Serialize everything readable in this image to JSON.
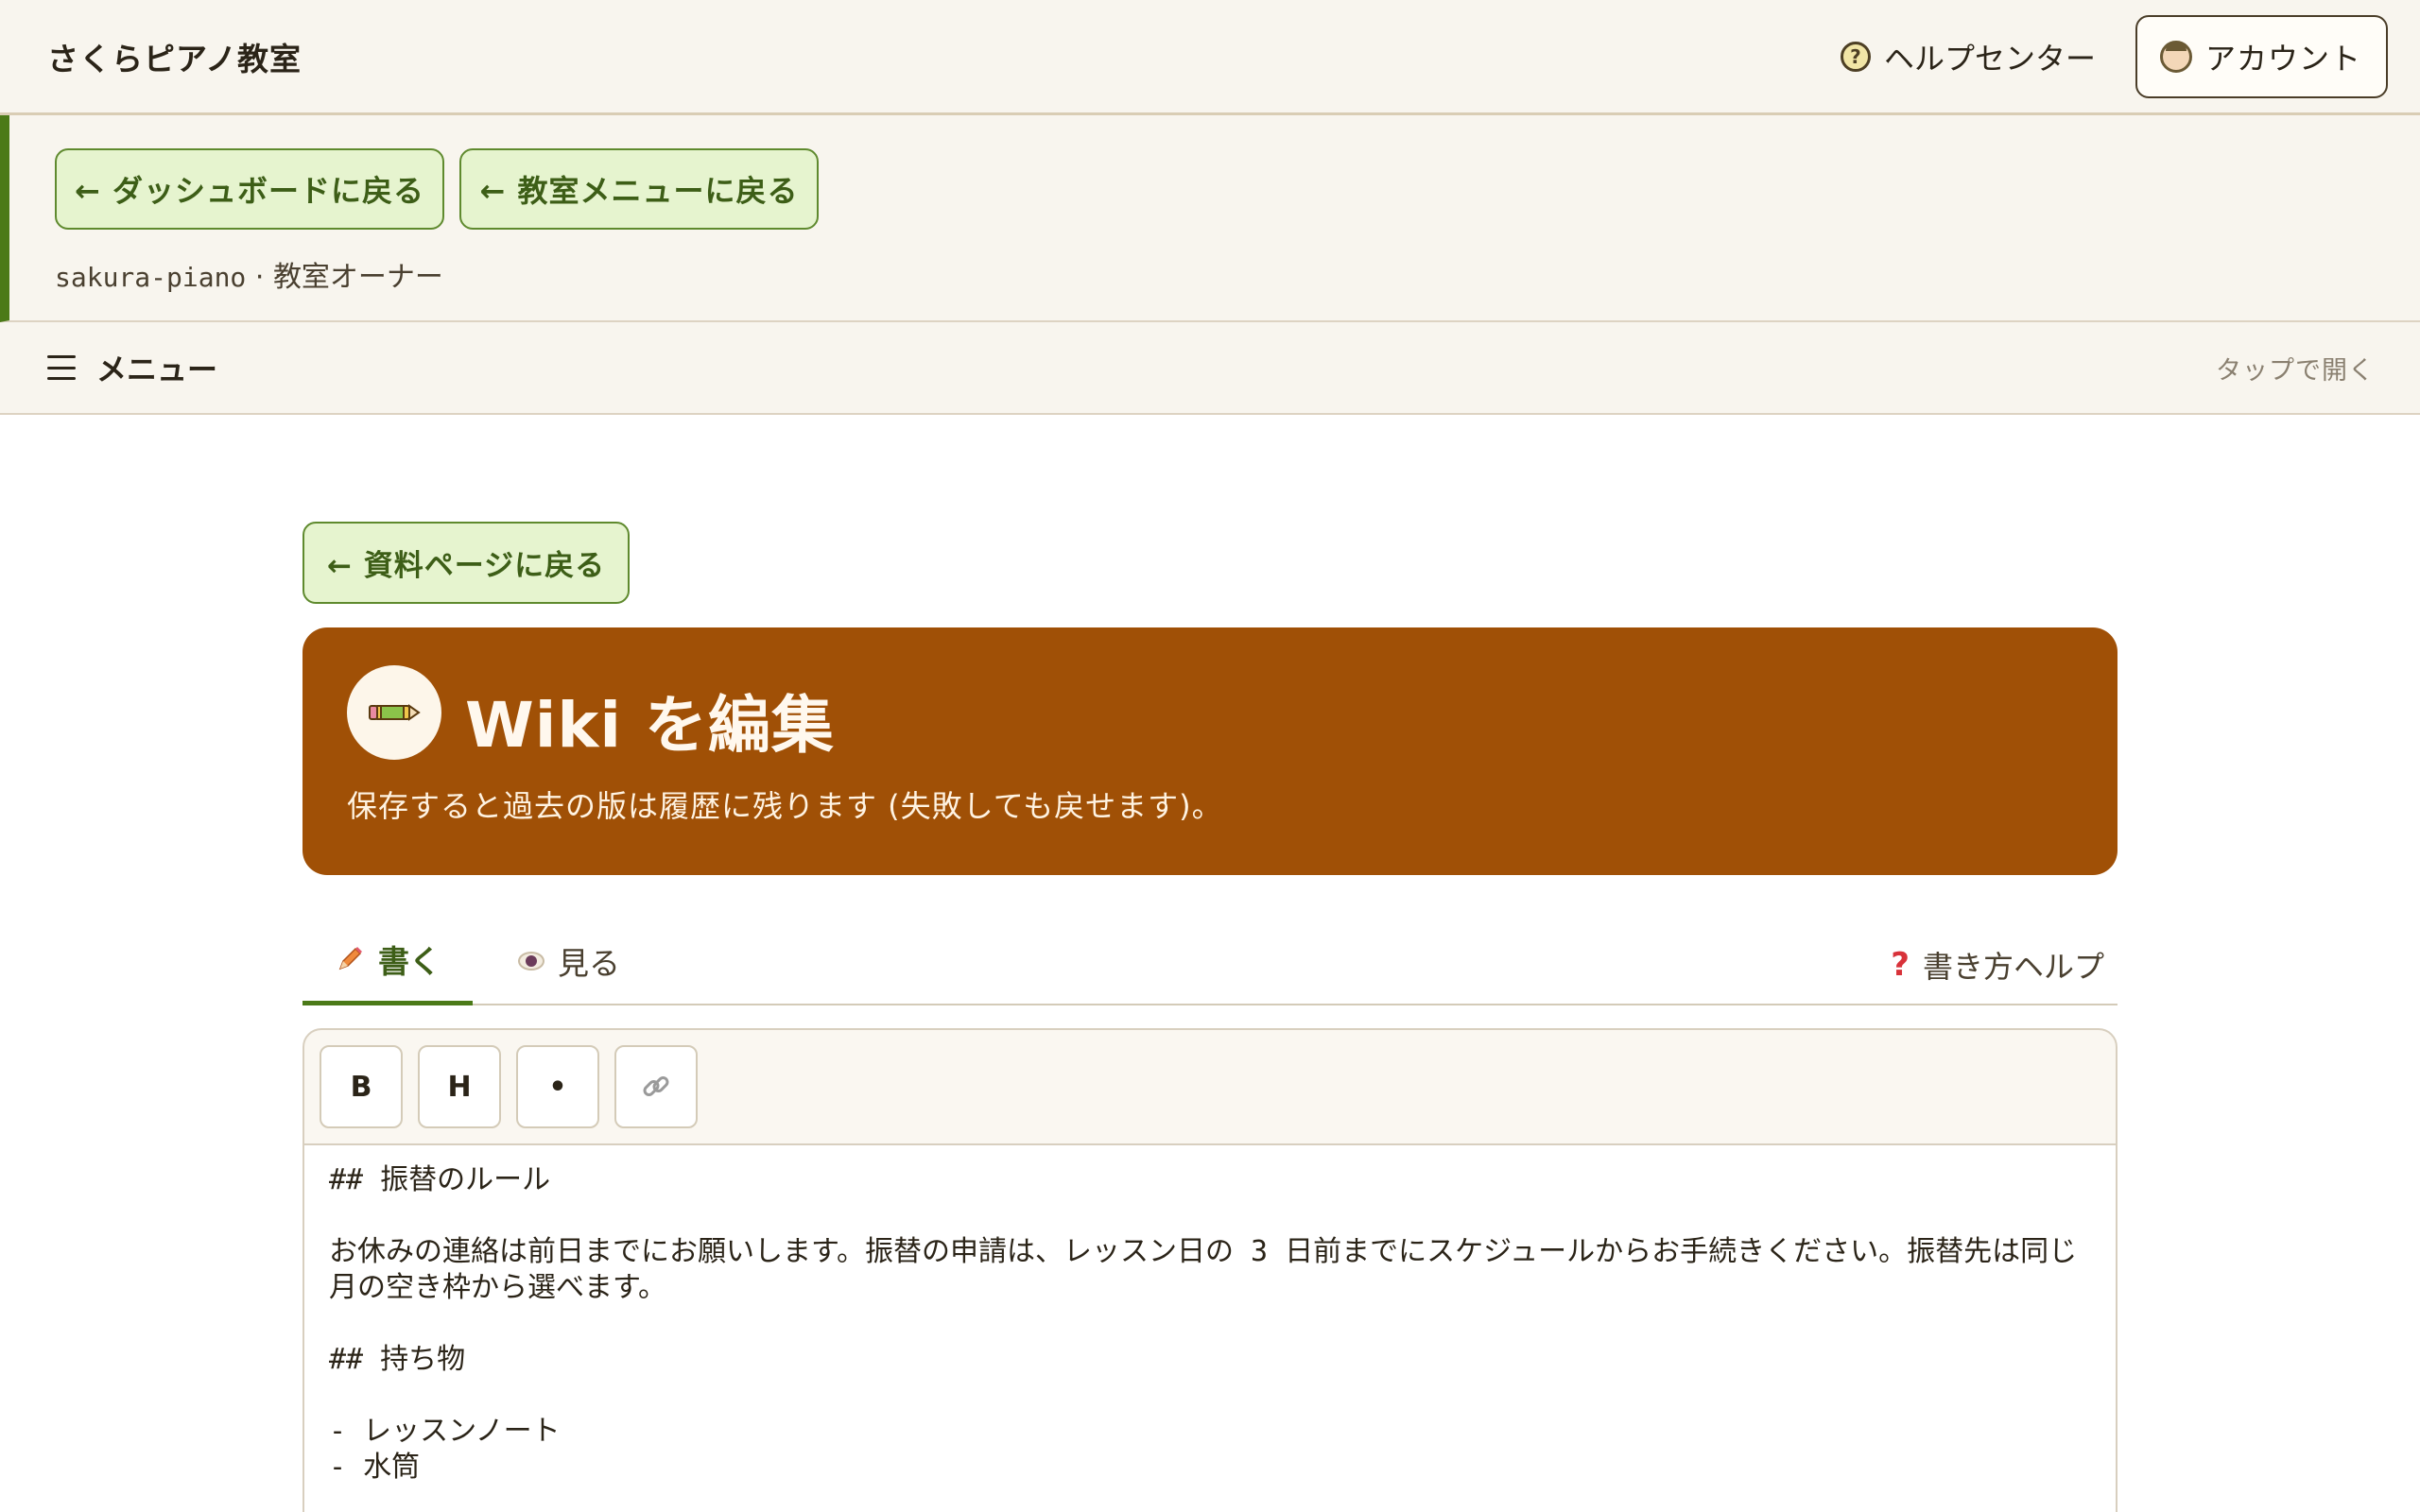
{
  "header": {
    "site_title": "さくらピアノ教室",
    "help_label": "ヘルプセンター",
    "account_label": "アカウント"
  },
  "context": {
    "dashboard_back": "← ダッシュボードに戻る",
    "menu_back": "← 教室メニューに戻る",
    "slug": "sakura-piano",
    "separator": "·",
    "role": "教室オーナー"
  },
  "menubar": {
    "label": "メニュー",
    "hint": "タップで開く"
  },
  "page": {
    "back_label": "← 資料ページに戻る",
    "title": "Wiki を編集",
    "subtitle": "保存すると過去の版は履歴に残ります (失敗しても戻せます)。"
  },
  "tabs": {
    "write": "書く",
    "view": "見る",
    "help": "書き方ヘルプ"
  },
  "toolbar": {
    "bold": "B",
    "heading": "H",
    "bullet": "•"
  },
  "editor": {
    "content": "## 振替のルール\n\nお休みの連絡は前日までにお願いします。振替の申請は、レッスン日の 3 日前までにスケジュールからお手続きください。振替先は同じ月の空き枠から選べます。\n\n## 持ち物\n\n- レッスンノート\n- 水筒"
  },
  "colors": {
    "accent_green": "#4b7a18",
    "hero_orange": "#a05006",
    "help_red": "#d8323a"
  },
  "icons": [
    "help-icon",
    "account-avatar-icon",
    "hamburger-icon",
    "pencil-icon",
    "eye-icon",
    "question-icon",
    "link-icon"
  ]
}
